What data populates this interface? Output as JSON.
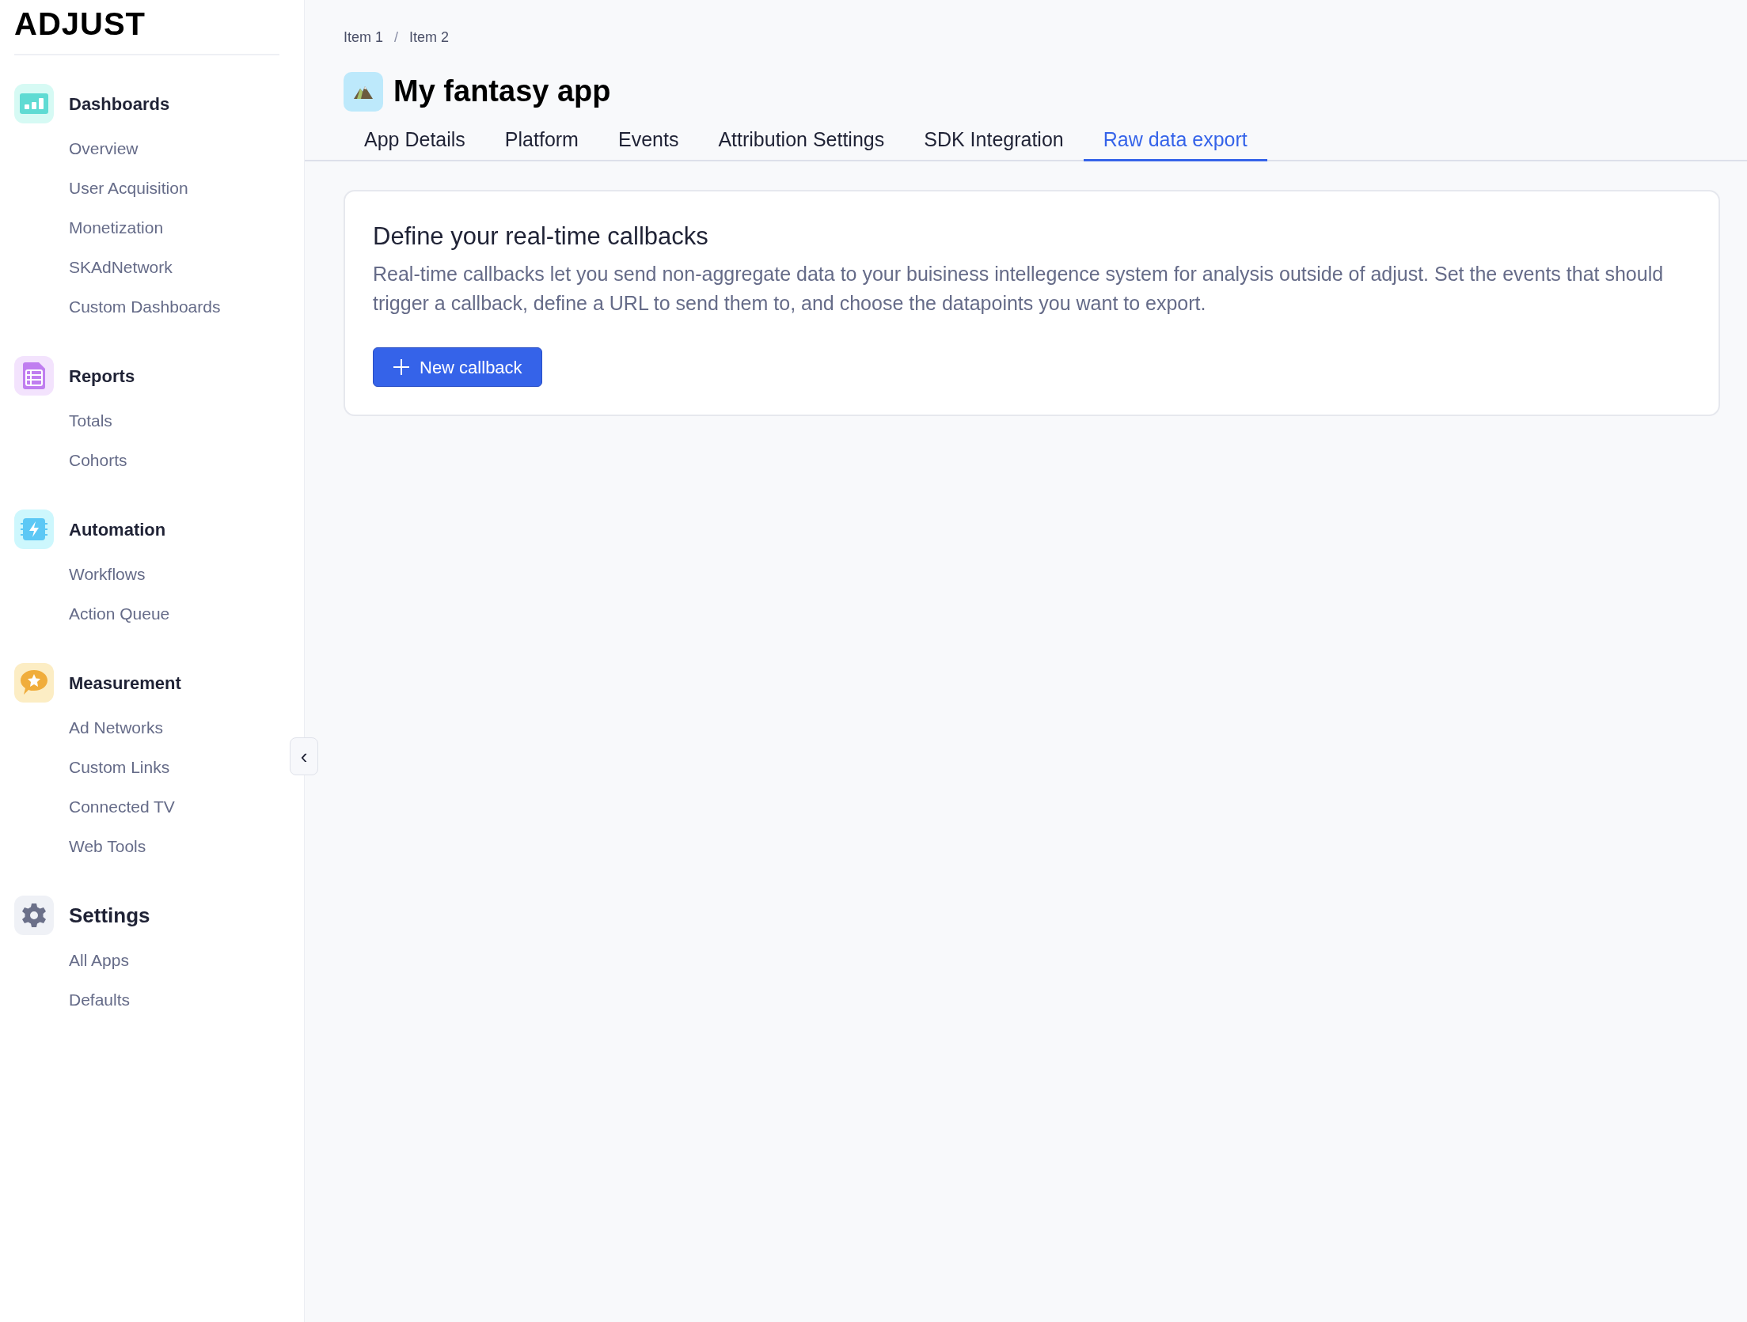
{
  "logo": {
    "text": "ADJUST"
  },
  "sidebar": {
    "groups": [
      {
        "label": "Dashboards",
        "items": [
          "Overview",
          "User Acquisition",
          "Monetization",
          "SKAdNetwork",
          "Custom Dashboards"
        ]
      },
      {
        "label": "Reports",
        "items": [
          "Totals",
          "Cohorts"
        ]
      },
      {
        "label": "Automation",
        "items": [
          "Workflows",
          "Action Queue"
        ]
      },
      {
        "label": "Measurement",
        "items": [
          "Ad Networks",
          "Custom Links",
          "Connected TV",
          "Web Tools"
        ]
      },
      {
        "label": "Settings",
        "items": [
          "All Apps",
          "Defaults"
        ]
      }
    ],
    "collapse_button": {
      "icon": "‹"
    }
  },
  "breadcrumb": [
    "Item 1",
    "Item 2"
  ],
  "breadcrumb_separator": "/",
  "app": {
    "title": "My fantasy app"
  },
  "tabs": [
    {
      "label": "App Details",
      "selected": false
    },
    {
      "label": "Platform",
      "selected": false
    },
    {
      "label": "Events",
      "selected": false
    },
    {
      "label": "Attribution Settings",
      "selected": false
    },
    {
      "label": "SDK Integration",
      "selected": false
    },
    {
      "label": "Raw data export",
      "selected": true
    }
  ],
  "card": {
    "title": "Define your real-time callbacks",
    "text": "Real-time callbacks let you send non-aggregate data to your buisiness intellegence system for analysis outside of adjust. Set the events that should trigger a callback, define a URL to send them to, and choose the datapoints you want to export.",
    "button": "New callback"
  }
}
